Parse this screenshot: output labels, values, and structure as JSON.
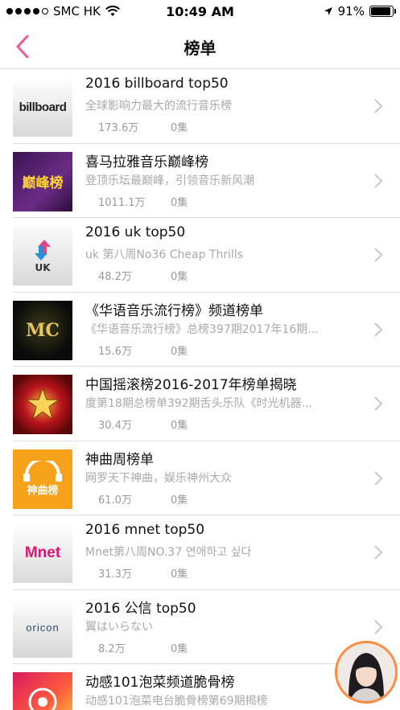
{
  "status_bar": {
    "carrier": "SMC HK",
    "time": "10:49 AM",
    "battery": "91%",
    "battery_level": 0.91
  },
  "nav": {
    "title": "榜单",
    "back_icon": "chevron-left-icon"
  },
  "accent_color": "#f05a9b",
  "items": [
    {
      "title": "2016 billboard top50",
      "desc": "全球影响力最大的流行音乐榜",
      "plays": "173.6万",
      "episodes": "0集",
      "thumb_text": "billboard"
    },
    {
      "title": "喜马拉雅音乐巅峰榜",
      "desc": "登顶乐坛最巅峰，引领音乐新风潮",
      "plays": "1011.1万",
      "episodes": "0集",
      "thumb_text": "巅峰榜"
    },
    {
      "title": "2016 uk top50",
      "desc": "uk 第八周No36 Cheap Thrills",
      "plays": "48.2万",
      "episodes": "0集",
      "thumb_text": "UK"
    },
    {
      "title": "《华语音乐流行榜》频道榜单",
      "desc": "《华语音乐流行榜》总榜397期2017年16期...",
      "plays": "15.6万",
      "episodes": "0集",
      "thumb_text": "MC"
    },
    {
      "title": "中国摇滚榜2016-2017年榜单揭晓",
      "desc": "度第18期总榜单392期舌头乐队《时光机器...",
      "plays": "30.4万",
      "episodes": "0集",
      "thumb_text": ""
    },
    {
      "title": "神曲周榜单",
      "desc": "网罗天下神曲，娱乐神州大众",
      "plays": "61.0万",
      "episodes": "0集",
      "thumb_text": "神曲榜"
    },
    {
      "title": "2016 mnet top50",
      "desc": "Mnet第八周NO.37 연애하고 싶다",
      "plays": "31.3万",
      "episodes": "0集",
      "thumb_text": "Mnet"
    },
    {
      "title": "2016 公信 top50",
      "desc": "翼はいらない",
      "plays": "8.2万",
      "episodes": "0集",
      "thumb_text": "oricon"
    },
    {
      "title": "动感101泡菜频道脆骨榜",
      "desc": "动感101泡菜电台脆骨榜第69期揭榜",
      "plays": "",
      "episodes": "",
      "thumb_text": ""
    }
  ]
}
